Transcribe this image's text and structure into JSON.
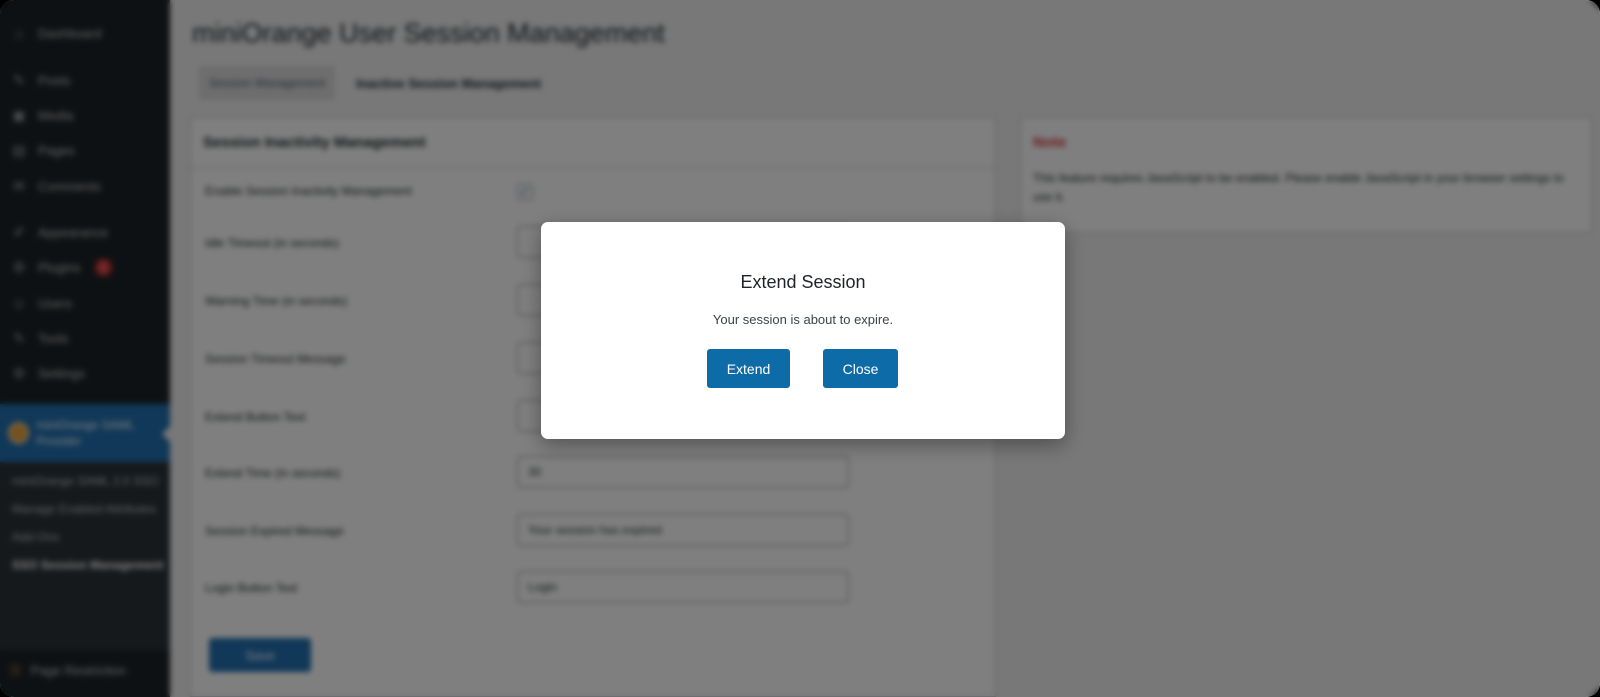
{
  "sidebar": {
    "top_items": [
      {
        "label": "Dashboard",
        "icon": "dashboard-icon",
        "glyph": "⌂"
      },
      {
        "label": "Posts",
        "icon": "pin-icon",
        "glyph": "✎"
      },
      {
        "label": "Media",
        "icon": "media-icon",
        "glyph": "▣"
      },
      {
        "label": "Pages",
        "icon": "page-icon",
        "glyph": "▤"
      },
      {
        "label": "Comments",
        "icon": "comment-icon",
        "glyph": "✉"
      },
      {
        "label": "Appearance",
        "icon": "brush-icon",
        "glyph": "✐"
      },
      {
        "label": "Plugins",
        "icon": "plugin-icon",
        "glyph": "⚙",
        "badge": "1"
      },
      {
        "label": "Users",
        "icon": "user-icon",
        "glyph": "☺"
      },
      {
        "label": "Tools",
        "icon": "wrench-icon",
        "glyph": "✎"
      },
      {
        "label": "Settings",
        "icon": "settings-icon",
        "glyph": "⚙"
      }
    ],
    "active_item": {
      "label": "miniOrange SAML Provider",
      "icon": "miniorange-logo-icon"
    },
    "submenu": [
      {
        "label": "miniOrange SAML 2.0 SSO"
      },
      {
        "label": "Manage Enabled Attributes"
      },
      {
        "label": "Add-Ons"
      },
      {
        "label": "SSO Session Management",
        "current": true
      }
    ],
    "bottom_item": {
      "label": "Page Restriction",
      "icon": "lock-icon",
      "glyph": "⚿"
    }
  },
  "main": {
    "title": "miniOrange User Session Management",
    "tabs": [
      {
        "label": "Session Management",
        "active": true
      },
      {
        "label": "Inactive Session Management",
        "active": false
      }
    ],
    "panel_title": "Session Inactivity Management",
    "fields": [
      {
        "label": "Enable Session Inactivity Management",
        "value": ""
      },
      {
        "label": "Idle Timeout (in seconds)",
        "value": ""
      },
      {
        "label": "Warning Time (in seconds)",
        "value": ""
      },
      {
        "label": "Session Timeout Message",
        "value": ""
      },
      {
        "label": "Extend Button Text",
        "value": ""
      },
      {
        "label": "Extend Time (in seconds)",
        "value": "30"
      },
      {
        "label": "Session Expired Message",
        "value": "Your session has expired"
      },
      {
        "label": "Login Button Text",
        "value": "Login"
      }
    ],
    "save_label": "Save",
    "note": {
      "title": "Note",
      "text": "This feature requires JavaScript to be enabled. Please enable JavaScript in your browser settings to use it."
    }
  },
  "modal": {
    "title": "Extend Session",
    "message": "Your session is about to expire.",
    "extend_label": "Extend",
    "close_label": "Close",
    "button_color": "#0d6ba8"
  },
  "colors": {
    "sidebar_bg": "#1d2327",
    "accent": "#2271b1",
    "note_title": "#d63638"
  }
}
